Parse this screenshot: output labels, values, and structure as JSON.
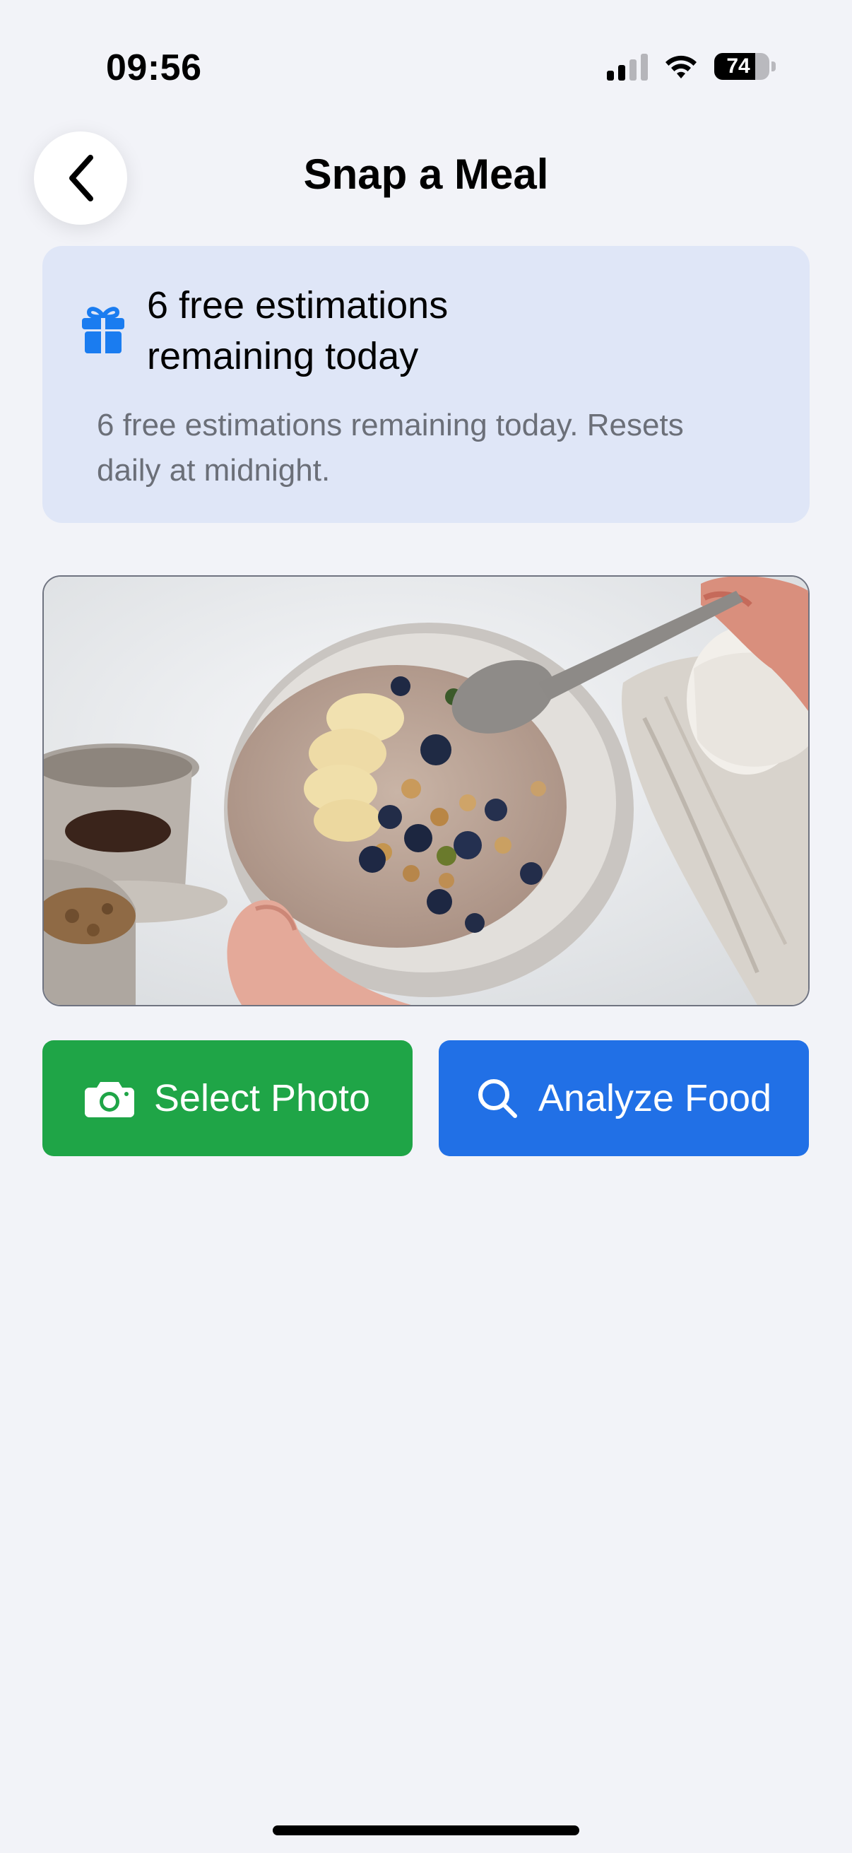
{
  "status_bar": {
    "time": "09:56",
    "battery_level": "74",
    "signal_bars_active": 2,
    "signal_bars_total": 4,
    "icons": [
      "cellular-signal-icon",
      "wifi-icon",
      "battery-icon"
    ]
  },
  "header": {
    "back_icon": "chevron-left-icon",
    "title": "Snap a Meal"
  },
  "info_card": {
    "icon": "gift-icon",
    "heading_line1": "6 free estimations",
    "heading_line2": "remaining today",
    "body_line1": "6 free estimations remaining today. Resets",
    "body_line2": "daily at midnight."
  },
  "meal_photo": {
    "subject": "oatmeal bowl with bananas, blueberries and granola"
  },
  "actions": {
    "select_photo": {
      "label": "Select Photo",
      "icon": "camera-icon",
      "color": "#1fa547"
    },
    "analyze_food": {
      "label": "Analyze Food",
      "icon": "search-icon",
      "color": "#2170e6"
    }
  },
  "colors": {
    "background": "#f2f3f8",
    "info_card": "#dfe6f7",
    "accent_blue": "#1a7cf0"
  }
}
